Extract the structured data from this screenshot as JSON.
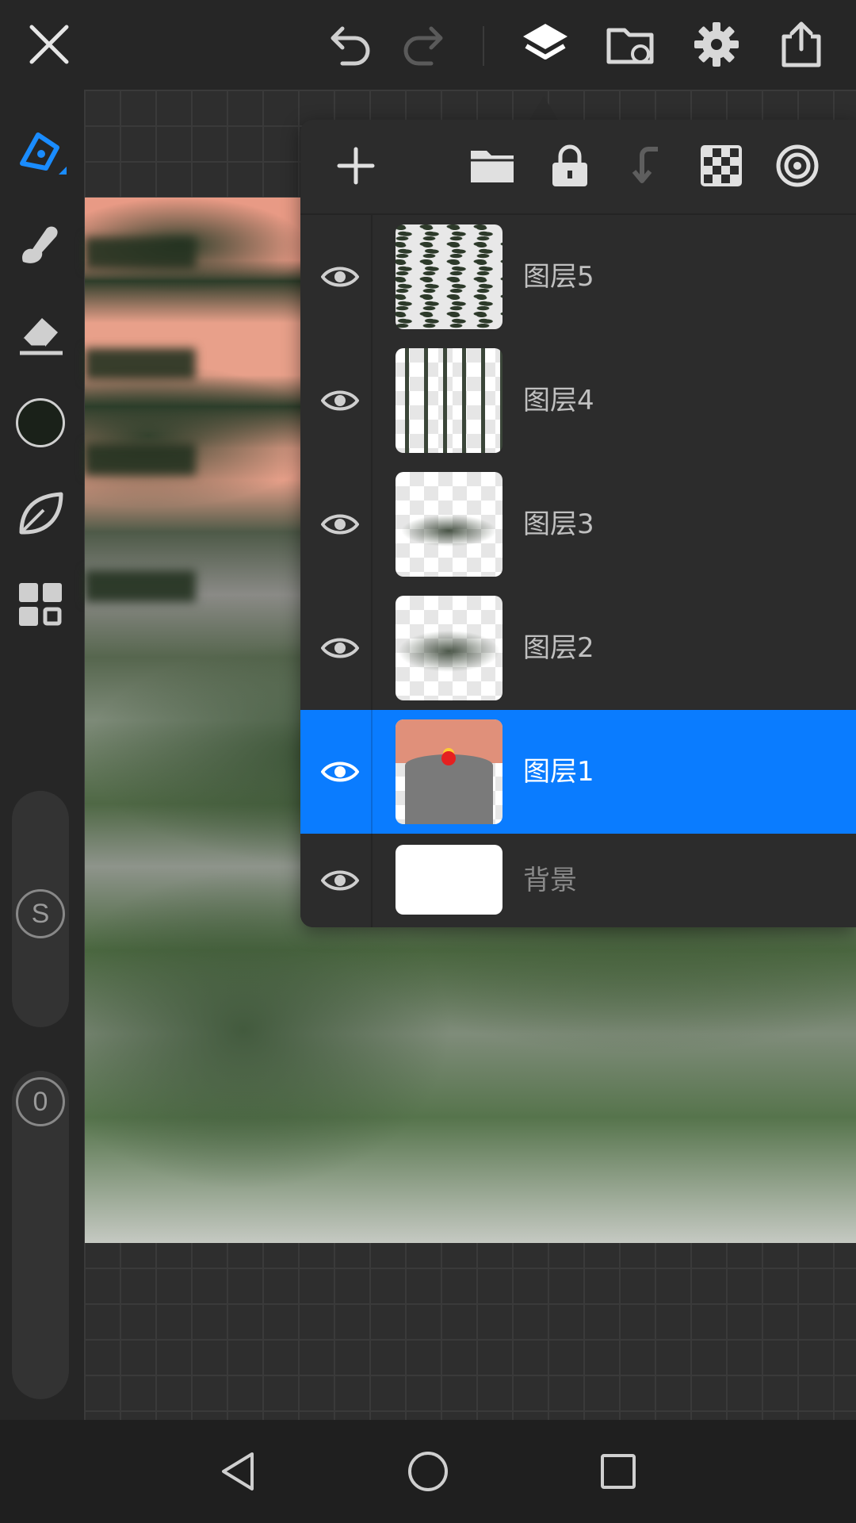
{
  "toolbar": {
    "icons": [
      "close-icon",
      "undo-icon",
      "redo-icon",
      "layers-icon",
      "gallery-folder-icon",
      "settings-icon",
      "share-icon"
    ]
  },
  "left_tools": {
    "icons": [
      "pen-tool-icon",
      "smudge-tool-icon",
      "eraser-tool-icon",
      "color-swatch",
      "leaf-icon",
      "grid-tools-icon"
    ],
    "color": "#1a2119",
    "size_knob_label": "S",
    "opacity_knob_label": "0"
  },
  "layers_panel": {
    "tools": [
      "add-layer-icon",
      "folder-icon",
      "lock-icon",
      "merge-down-icon",
      "transparency-icon",
      "blend-mode-icon"
    ],
    "layers": [
      {
        "name": "图层5",
        "visible": true,
        "selected": false
      },
      {
        "name": "图层4",
        "visible": true,
        "selected": false
      },
      {
        "name": "图层3",
        "visible": true,
        "selected": false
      },
      {
        "name": "图层2",
        "visible": true,
        "selected": false
      },
      {
        "name": "图层1",
        "visible": true,
        "selected": true
      },
      {
        "name": "背景",
        "visible": true,
        "selected": false
      }
    ]
  },
  "colors": {
    "accent": "#0a7cff",
    "background": "#262626",
    "panel": "#2c2c2c"
  },
  "navbar": {
    "icons": [
      "back-icon",
      "home-icon",
      "recents-icon"
    ]
  }
}
